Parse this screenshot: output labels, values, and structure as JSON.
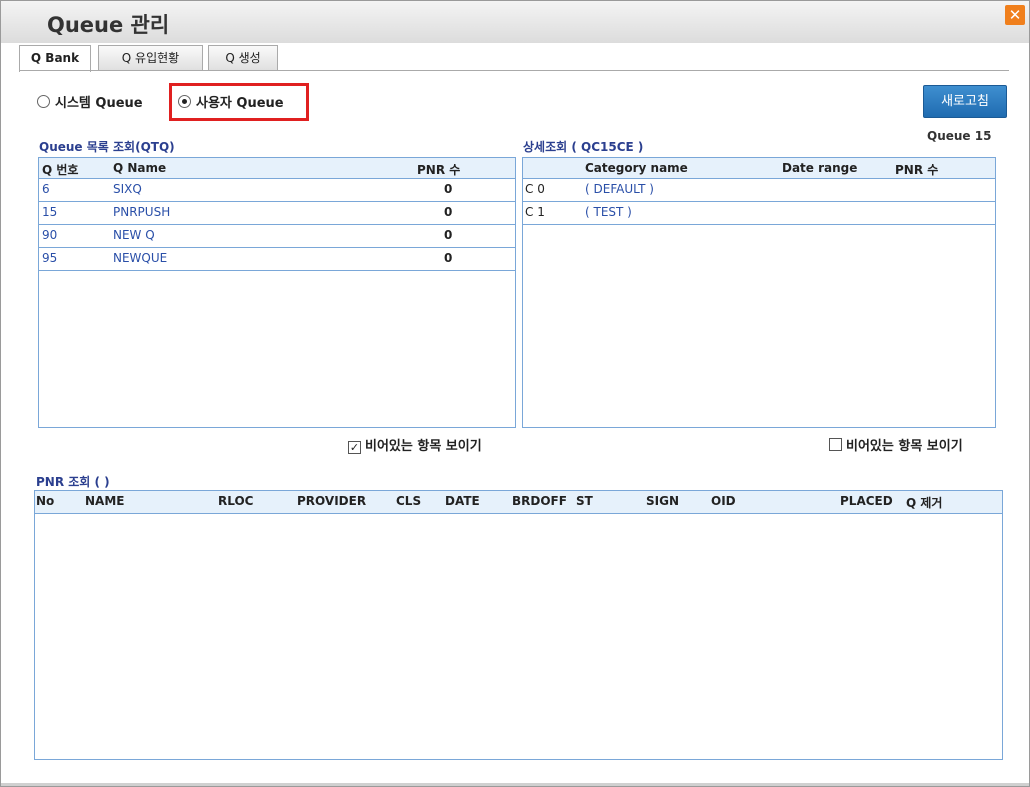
{
  "window": {
    "title": "Queue 관리",
    "close_symbol": "✕"
  },
  "tabs": [
    {
      "label": "Q Bank",
      "active": true
    },
    {
      "label": "Q 유입현황",
      "active": false
    },
    {
      "label": "Q 생성",
      "active": false
    }
  ],
  "radios": {
    "system": {
      "label": "시스템 Queue",
      "checked": false
    },
    "user": {
      "label": "사용자 Queue",
      "checked": true
    }
  },
  "refresh_label": "새로고침",
  "queue_list": {
    "title": "Queue 목록 조회(QTQ)",
    "columns": [
      "Q 번호",
      "Q Name",
      "PNR 수"
    ],
    "rows": [
      {
        "num": "6",
        "name": "SIXQ",
        "pnr": "0"
      },
      {
        "num": "15",
        "name": "PNRPUSH",
        "pnr": "0"
      },
      {
        "num": "90",
        "name": "NEW Q",
        "pnr": "0"
      },
      {
        "num": "95",
        "name": "NEWQUE",
        "pnr": "0"
      }
    ],
    "show_empty_label": "비어있는 항목 보이기",
    "show_empty_checked": true
  },
  "detail": {
    "title": "상세조회 ( QC15CE )",
    "queue_label": "Queue 15",
    "columns": [
      "Category name",
      "Date range",
      "PNR 수"
    ],
    "rows": [
      {
        "code": "C 0",
        "name": "( DEFAULT )"
      },
      {
        "code": "C 1",
        "name": "( TEST )"
      }
    ],
    "show_empty_label": "비어있는 항목 보이기",
    "show_empty_checked": false
  },
  "pnr": {
    "title": "PNR 조회 ( )",
    "columns": [
      "No",
      "NAME",
      "RLOC",
      "PROVIDER",
      "CLS",
      "DATE",
      "BRDOFF",
      "ST",
      "SIGN",
      "OID",
      "PLACED",
      "Q 제거"
    ]
  }
}
